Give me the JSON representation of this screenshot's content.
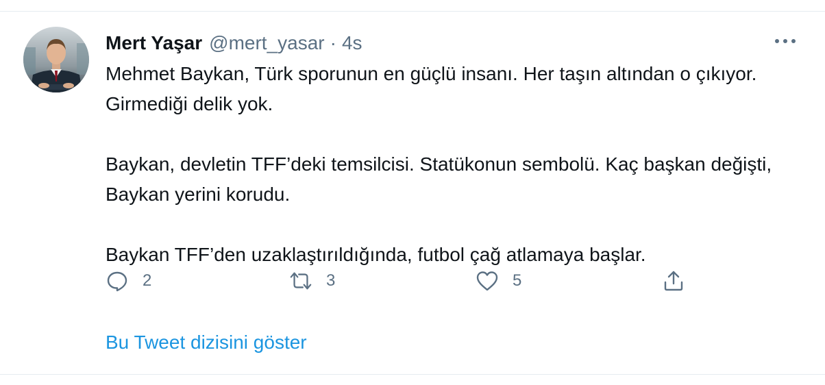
{
  "tweet": {
    "author_name": "Mert Yaşar",
    "handle": "@mert_yasar",
    "separator": "·",
    "timestamp": "4s",
    "paragraphs": [
      "Mehmet Baykan, Türk sporunun en güçlü insanı. Her taşın altından o çıkıyor. Girmediği delik yok.",
      "Baykan, devletin TFF’deki temsilcisi. Statükonun sembolü. Kaç başkan değişti, Baykan yerini korudu.",
      "Baykan TFF’den uzaklaştırıldığında, futbol çağ atlamaya başlar."
    ]
  },
  "actions": {
    "reply": {
      "icon": "reply-icon",
      "count": "2"
    },
    "retweet": {
      "icon": "retweet-icon",
      "count": "3"
    },
    "like": {
      "icon": "heart-icon",
      "count": "5"
    },
    "share": {
      "icon": "share-icon"
    }
  },
  "more_icon": "more-icon",
  "show_thread_label": "Bu Tweet dizisini göster",
  "colors": {
    "text": "#0f1419",
    "secondary": "#5b7083",
    "link": "#1b95e0",
    "divider": "#e6ecf0"
  }
}
